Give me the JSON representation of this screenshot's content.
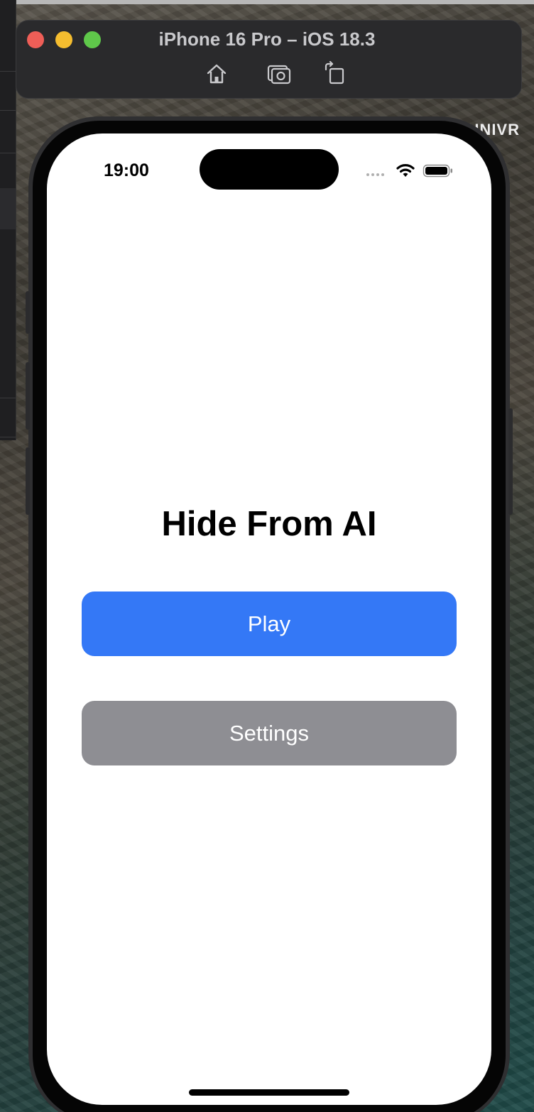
{
  "window": {
    "title": "iPhone 16 Pro – iOS 18.3",
    "toolbar": [
      "home-icon",
      "screenshot-icon",
      "rotate-icon"
    ]
  },
  "desktop": {
    "corner_text": "UNIVR"
  },
  "status_bar": {
    "time": "19:00",
    "icons": [
      "cellular-signal-icon",
      "wifi-icon",
      "battery-icon"
    ]
  },
  "app": {
    "title": "Hide From AI",
    "play_label": "Play",
    "settings_label": "Settings"
  },
  "colors": {
    "play_button": "#3478f6",
    "settings_button": "#8e8e93",
    "screen_background": "#ffffff"
  }
}
